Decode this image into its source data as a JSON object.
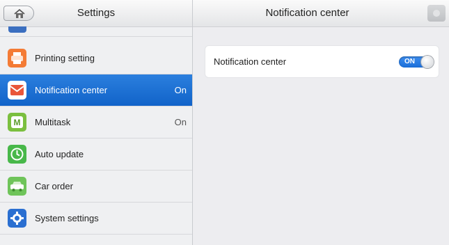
{
  "left_panel": {
    "title": "Settings",
    "home_icon": "home-icon",
    "items": [
      {
        "label": "Printing setting",
        "value": "",
        "icon": "printer-icon",
        "icon_color": "#f47b35",
        "selected": false
      },
      {
        "label": "Notification center",
        "value": "On",
        "icon": "notification-icon",
        "icon_color": "#e9563a",
        "selected": true
      },
      {
        "label": "Multitask",
        "value": "On",
        "icon": "multitask-icon",
        "icon_color": "#7bbf3f",
        "selected": false
      },
      {
        "label": "Auto update",
        "value": "",
        "icon": "clock-icon",
        "icon_color": "#48b84a",
        "selected": false
      },
      {
        "label": "Car order",
        "value": "",
        "icon": "car-icon",
        "icon_color": "#6fc45a",
        "selected": false
      },
      {
        "label": "System settings",
        "value": "",
        "icon": "gear-icon",
        "icon_color": "#2a6fd1",
        "selected": false
      }
    ]
  },
  "right_panel": {
    "title": "Notification center",
    "setting": {
      "label": "Notification center",
      "toggle_state": "ON"
    }
  },
  "colors": {
    "selected_bg": "#1a6fd6",
    "toggle_on": "#2a7ee6"
  }
}
